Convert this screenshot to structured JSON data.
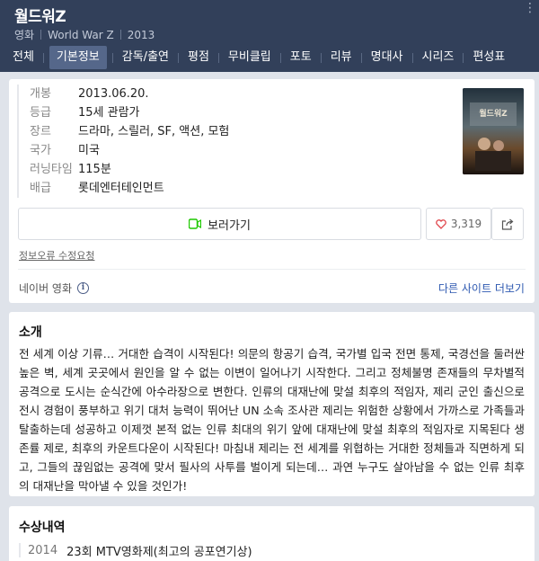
{
  "header": {
    "title": "월드워Z",
    "meta": [
      "영화",
      "World War Z",
      "2013"
    ]
  },
  "tabs": [
    {
      "label": "전체",
      "active": false
    },
    {
      "label": "기본정보",
      "active": true
    },
    {
      "label": "감독/출연",
      "active": false
    },
    {
      "label": "평점",
      "active": false
    },
    {
      "label": "무비클립",
      "active": false
    },
    {
      "label": "포토",
      "active": false
    },
    {
      "label": "리뷰",
      "active": false
    },
    {
      "label": "명대사",
      "active": false
    },
    {
      "label": "시리즈",
      "active": false
    },
    {
      "label": "편성표",
      "active": false
    }
  ],
  "info": {
    "rows": [
      {
        "key": "개봉",
        "value": "2013.06.20."
      },
      {
        "key": "등급",
        "value": "15세 관람가"
      },
      {
        "key": "장르",
        "value": "드라마, 스릴러, SF, 액션, 모험"
      },
      {
        "key": "국가",
        "value": "미국"
      },
      {
        "key": "러닝타임",
        "value": "115분"
      },
      {
        "key": "배급",
        "value": "롯데엔터테인먼트"
      }
    ],
    "poster_text": "월드워Z",
    "watch_label": "보러가기",
    "like_count": "3,319",
    "report_label": "정보오류 수정요청",
    "source_label": "네이버 영화",
    "more_sites_label": "다른 사이트 더보기"
  },
  "synopsis": {
    "title": "소개",
    "text": "전 세계 이상 기류… 거대한 습격이 시작된다! 의문의 항공기 습격, 국가별 입국 전면 통제, 국경선을 둘러싼 높은 벽, 세계 곳곳에서 원인을 알 수 없는 이변이 일어나기 시작한다. 그리고 정체불명 존재들의 무차별적 공격으로 도시는 순식간에 아수라장으로 변한다. 인류의 대재난에 맞설 최후의 적임자, 제리 군인 출신으로 전시 경험이 풍부하고 위기 대처 능력이 뛰어난 UN 소속 조사관 제리는 위험한 상황에서 가까스로 가족들과 탈출하는데 성공하고 이제껏 본적 없는 인류 최대의 위기 앞에 대재난에 맞설 최후의 적임자로 지목된다 생존률 제로, 최후의 카운트다운이 시작된다! 마침내 제리는 전 세계를 위협하는 거대한 정체들과 직면하게 되고, 그들의 끊임없는 공격에 맞서 필사의 사투를 벌이게 되는데… 과연 누구도 살아남을 수 없는 인류 최후의 대재난을 막아낼 수 있을 것인가!"
  },
  "awards": {
    "title": "수상내역",
    "items": [
      {
        "year": "2014",
        "name": "23회 MTV영화제(최고의 공포연기상)"
      }
    ]
  },
  "colors": {
    "header_bg": "#32405a",
    "active_tab": "#55678a",
    "link": "#2d58b0",
    "play_green": "#1ec800",
    "heart_red": "#e0464c"
  }
}
